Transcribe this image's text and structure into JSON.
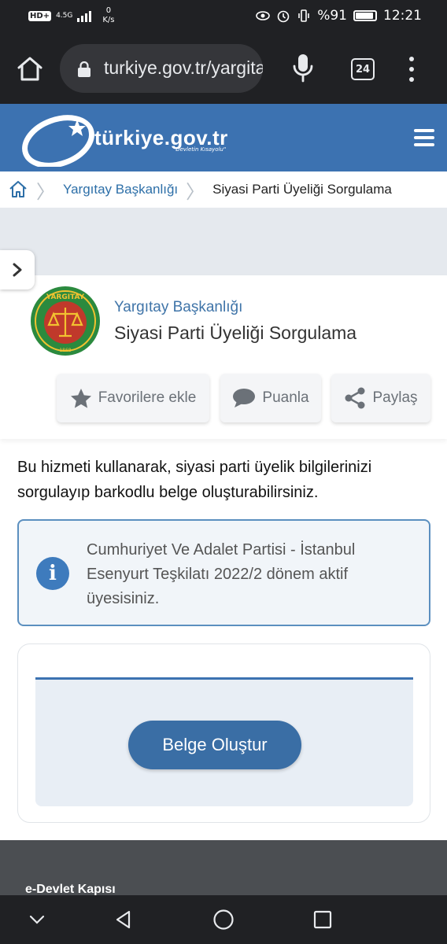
{
  "status_bar": {
    "hd_badge": "HD+",
    "network_type": "4.5G",
    "data_speed_value": "0",
    "data_speed_unit": "K/s",
    "battery_percent": "%91",
    "time": "12:21"
  },
  "browser": {
    "url": "turkiye.gov.tr/yargitay",
    "tab_count": "24"
  },
  "site_header": {
    "logo_text": "türkiye.gov.tr",
    "logo_tagline": "\"Devletin Kısayolu\""
  },
  "breadcrumb": {
    "items": [
      "Yargıtay Başkanlığı",
      "Siyasi Parti Üyeliği Sorgulama"
    ]
  },
  "service": {
    "institution": "Yargıtay Başkanlığı",
    "title": "Siyasi Parti Üyeliği Sorgulama",
    "seal_text": "YARGITAY",
    "seal_year": "1868",
    "actions": {
      "favorite": "Favorilere ekle",
      "rate": "Puanla",
      "share": "Paylaş"
    }
  },
  "description": "Bu hizmeti kullanarak, siyasi parti üyelik bilgilerinizi sorgulayıp barkodlu belge oluşturabilirsiniz.",
  "info_alert": {
    "message": "Cumhuriyet Ve Adalet Partisi - İstanbul Esenyurt Teşkilatı 2022/2 dönem aktif üyesisiniz."
  },
  "form": {
    "primary_button": "Belge Oluştur"
  },
  "footer": {
    "title": "e-Devlet Kapısı"
  },
  "colors": {
    "brand_blue": "#3c72b1",
    "link_blue": "#2d6fa8",
    "button_blue": "#3a6ea5",
    "browser_dark": "#202124"
  }
}
